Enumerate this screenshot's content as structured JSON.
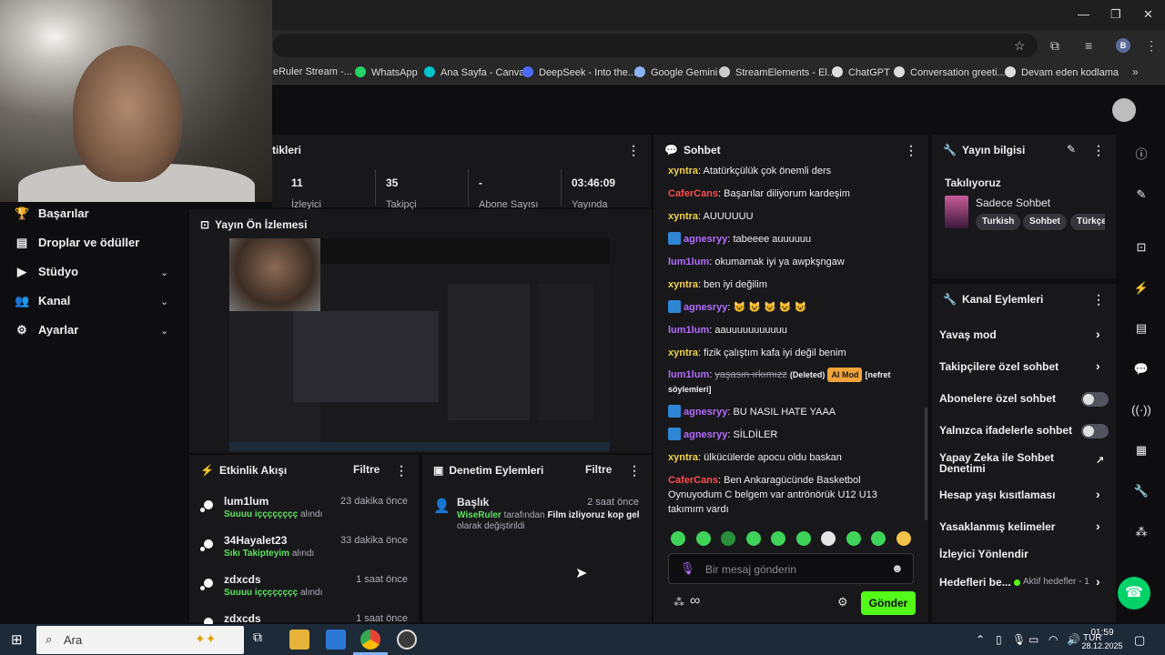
{
  "bookmarks": [
    {
      "label": "eRuler Stream -...",
      "icon": "page-icon",
      "color": "#aaaaaa"
    },
    {
      "label": "WhatsApp",
      "icon": "whatsapp-icon",
      "color": "#25d366"
    },
    {
      "label": "Ana Sayfa - Canva",
      "icon": "canva-icon",
      "color": "#00c4cc"
    },
    {
      "label": "DeepSeek - Into the...",
      "icon": "deepseek-icon",
      "color": "#4d6bfe"
    },
    {
      "label": "Google Gemini",
      "icon": "gemini-icon",
      "color": "#8ab4f8"
    },
    {
      "label": "StreamElements - El...",
      "icon": "streamelements-icon",
      "color": "#cccccc"
    },
    {
      "label": "ChatGPT",
      "icon": "chatgpt-icon",
      "color": "#dddddd"
    },
    {
      "label": "Conversation greeti...",
      "icon": "chatgpt-icon",
      "color": "#dddddd"
    },
    {
      "label": "Devam eden kodlama",
      "icon": "chatgpt-icon",
      "color": "#dddddd"
    }
  ],
  "nav": {
    "items": [
      {
        "label": "Başarılar",
        "icon": "trophy-icon"
      },
      {
        "label": "Droplar ve ödüller",
        "icon": "gift-icon"
      },
      {
        "label": "Stüdyo",
        "icon": "video-icon"
      },
      {
        "label": "Kanal",
        "icon": "people-icon"
      },
      {
        "label": "Ayarlar",
        "icon": "gear-icon"
      }
    ]
  },
  "stats": {
    "title": "tikleri",
    "items": [
      {
        "value": "11",
        "label": "İzleyici"
      },
      {
        "value": "35",
        "label": "Takipçi"
      },
      {
        "value": "-",
        "label": "Abone Sayısı"
      },
      {
        "value": "03:46:09",
        "label": "Yayında"
      }
    ]
  },
  "preview": {
    "title": "Yayın Ön İzlemesi"
  },
  "activity": {
    "title": "Etkinlik Akışı",
    "filter": "Filtre",
    "items": [
      {
        "name": "lum1lum",
        "reward": "Suuuu içççççççç",
        "suffix": "alındı",
        "time": "23 dakika önce"
      },
      {
        "name": "34Hayalet23",
        "reward": "Sıkı Takipteyim",
        "suffix": "alındı",
        "time": "33 dakika önce"
      },
      {
        "name": "zdxcds",
        "reward": "Suuuu içççççççç",
        "suffix": "alındı",
        "time": "1 saat önce"
      },
      {
        "name": "zdxcds",
        "reward": "",
        "suffix": "",
        "time": "1 saat önce"
      }
    ]
  },
  "moderation": {
    "title": "Denetim Eylemleri",
    "filter": "Filtre",
    "item": {
      "title": "Başlık",
      "actor": "WiseRuler",
      "middle": "tarafından",
      "value": "Film izliyoruz kop gel",
      "suffix": "olarak değiştirildi",
      "time": "2 saat önce"
    }
  },
  "chat": {
    "title": "Sohbet",
    "messages": [
      {
        "user": "xyntra",
        "color": "#f0d24a",
        "badge": false,
        "text": "Atatürkçülük çok önemli ders"
      },
      {
        "user": "CaferCans",
        "color": "#ff4d4d",
        "badge": false,
        "text": "Başarılar diliyorum kardeşim"
      },
      {
        "user": "xyntra",
        "color": "#f0d24a",
        "badge": false,
        "text": "AUUUUUU"
      },
      {
        "user": "agnesryy",
        "color": "#b36bff",
        "badge": true,
        "text": "tabeeee auuuuuu"
      },
      {
        "user": "lum1lum",
        "color": "#b36bff",
        "badge": false,
        "text": "okumamak iyi ya awpkşngaw"
      },
      {
        "user": "xyntra",
        "color": "#f0d24a",
        "badge": false,
        "text": "ben iyi değilim"
      },
      {
        "user": "agnesryy",
        "color": "#b36bff",
        "badge": true,
        "text": "😺 😺 😺 😺 😺"
      },
      {
        "user": "lum1lum",
        "color": "#b36bff",
        "badge": false,
        "text": "aauuuuuuuuuuu"
      },
      {
        "user": "xyntra",
        "color": "#f0d24a",
        "badge": false,
        "text": "fizik çalıştım kafa iyi değil benim"
      },
      {
        "user": "lum1lum",
        "color": "#b36bff",
        "badge": false,
        "deleted": true,
        "text": "yaşasın ırkımızz",
        "deleted_label": "(Deleted)",
        "mod_label": "AI Mod",
        "reason": "[nefret söylemleri]"
      },
      {
        "user": "agnesryy",
        "color": "#b36bff",
        "badge": true,
        "text": "BU NASIL HATE YAAA"
      },
      {
        "user": "agnesryy",
        "color": "#b36bff",
        "badge": true,
        "text": "SİLDİLER"
      },
      {
        "user": "xyntra",
        "color": "#f0d24a",
        "badge": false,
        "text": "ülkücülerde apocu oldu baskan"
      },
      {
        "user": "CaferCans",
        "color": "#ff4d4d",
        "badge": false,
        "text": "Ben Ankaragücünde Basketbol Oynuyodum C belgem var antrönörük U12 U13 takımım vardı"
      }
    ],
    "input_placeholder": "Bir mesaj gönderin",
    "send_label": "Gönder",
    "points": "∞"
  },
  "stream_info": {
    "title": "Yayın bilgisi",
    "following": "Takılıyoruz",
    "category": "Sadece Sohbet",
    "tags": [
      "Turkish",
      "Sohbet",
      "Türkçe"
    ]
  },
  "channel_actions": {
    "title": "Kanal Eylemleri",
    "items": [
      {
        "label": "Yavaş mod",
        "control": "arrow"
      },
      {
        "label": "Takipçilere özel sohbet",
        "control": "arrow"
      },
      {
        "label": "Abonelere özel sohbet",
        "control": "toggle"
      },
      {
        "label": "Yalnızca ifadelerle sohbet",
        "control": "toggle"
      },
      {
        "label": "Yapay Zeka ile Sohbet Denetimi",
        "control": "external"
      },
      {
        "label": "Hesap yaşı kısıtlaması",
        "control": "arrow"
      },
      {
        "label": "Yasaklanmış kelimeler",
        "control": "arrow"
      },
      {
        "label": "İzleyici Yönlendir",
        "control": "none"
      },
      {
        "label": "Hedefleri be...",
        "control": "arrow",
        "status": "Aktif hedefler - 1"
      }
    ]
  },
  "taskbar": {
    "search_placeholder": "Ara",
    "time": "01:59",
    "date": "28.12.2025"
  },
  "colors": {
    "accent": "#53fc18",
    "bg": "#0e0e10",
    "panel": "#18181b"
  }
}
